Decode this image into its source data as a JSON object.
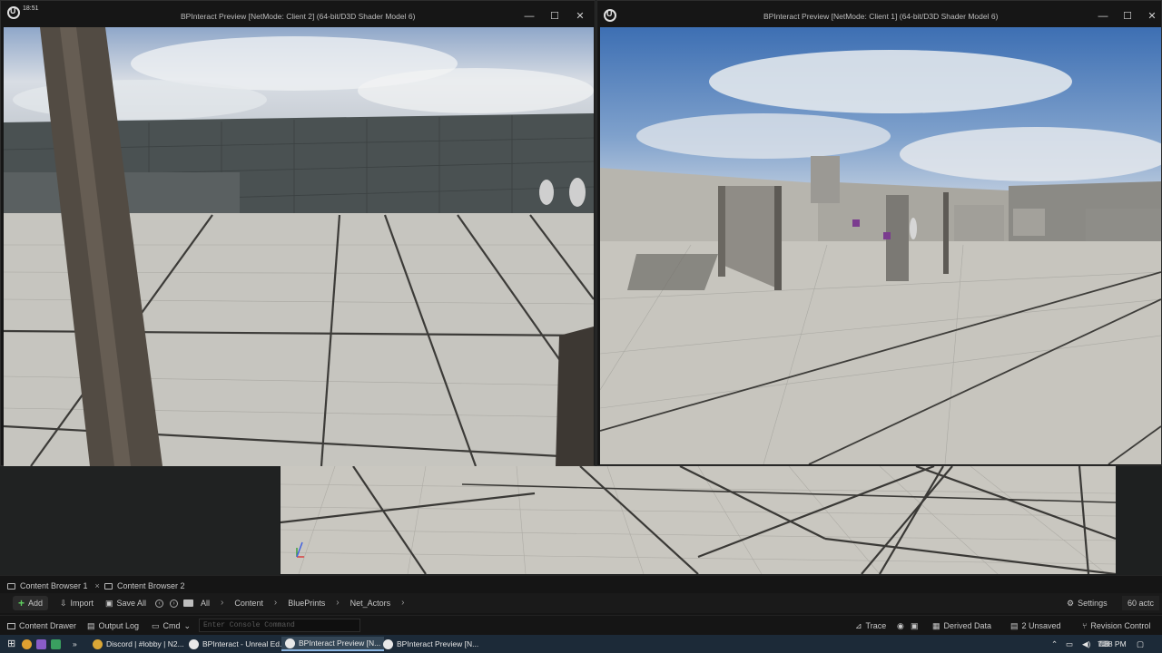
{
  "system": {
    "clock": "18:51"
  },
  "windows": {
    "client2": {
      "title": "BPInteract Preview [NetMode: Client 2]  (64-bit/D3D Shader Model 6)",
      "minimize": "—",
      "maximize": "☐",
      "close": "✕"
    },
    "client1": {
      "title": "BPInteract Preview [NetMode: Client 1]  (64-bit/D3D Shader Model 6)",
      "minimize": "—",
      "maximize": "☐",
      "close": "✕"
    }
  },
  "content_browser": {
    "tabs": [
      {
        "label": "Content Browser 1",
        "close": "×"
      },
      {
        "label": "Content Browser 2"
      }
    ],
    "toolbar": {
      "add": "Add",
      "import": "Import",
      "save_all": "Save All",
      "breadcrumb": [
        "All",
        "Content",
        "BluePrints",
        "Net_Actors"
      ],
      "settings": "Settings",
      "actors_count": "60 actc"
    }
  },
  "statusbar": {
    "content_drawer": "Content Drawer",
    "output_log": "Output Log",
    "cmd": "Cmd",
    "console_placeholder": "Enter Console Command",
    "trace": "Trace",
    "derived_data": "Derived Data",
    "unsaved": "2 Unsaved",
    "revision_control": "Revision Control"
  },
  "taskbar": {
    "items": [
      {
        "label": "Discord | #lobby | N2..."
      },
      {
        "label": "BPInteract - Unreal Ed..."
      },
      {
        "label": "BPInteract Preview [N..."
      },
      {
        "label": "BPInteract Preview [N..."
      }
    ],
    "time": "7:58 PM"
  },
  "colors": {
    "accent_green": "#5fcf5f",
    "taskbar": "#1c2a38",
    "editor_bg": "#151515"
  }
}
